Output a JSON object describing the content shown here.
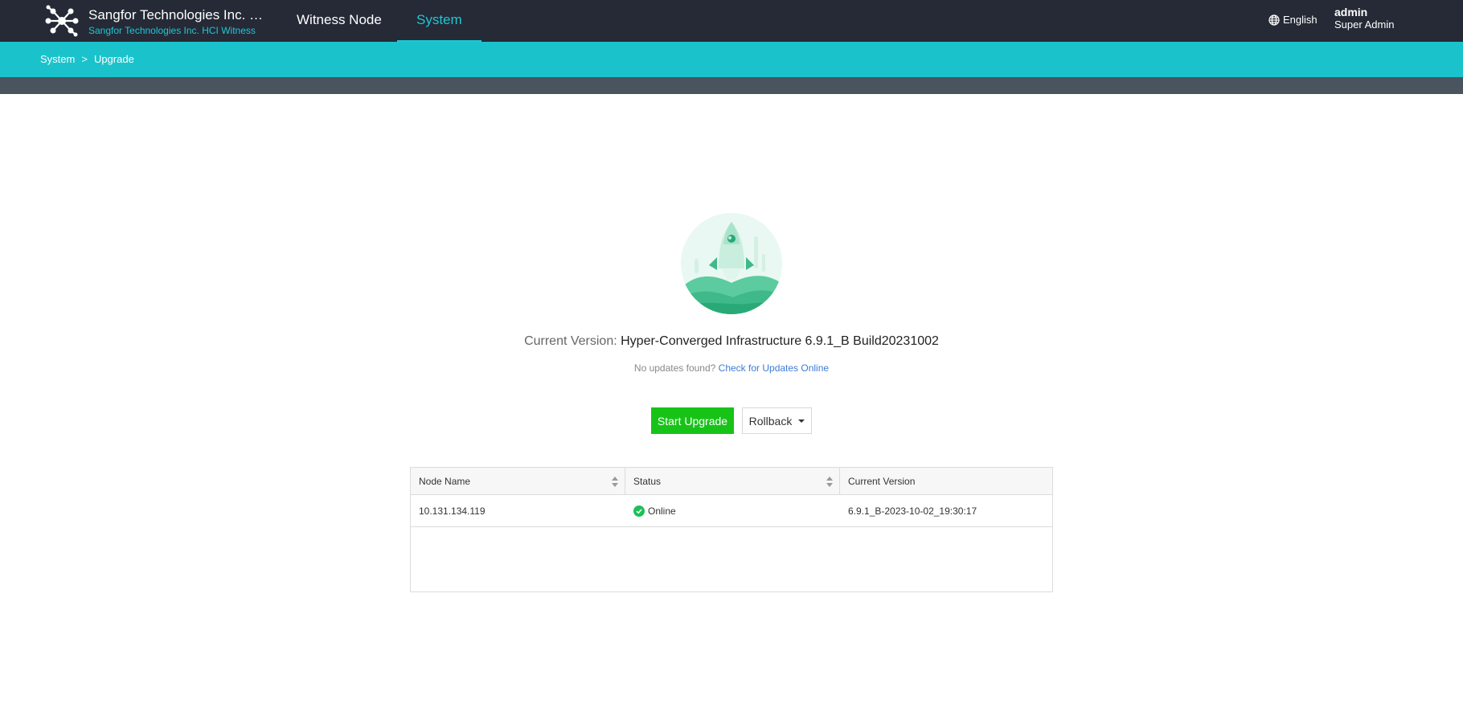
{
  "header": {
    "brand_title": "Sangfor Technologies Inc. HCI Witness",
    "brand_subtitle": "Sangfor Technologies Inc. HCI Witness",
    "nav": [
      {
        "label": "Witness Node",
        "active": false
      },
      {
        "label": "System",
        "active": true
      }
    ],
    "language": "English",
    "user_name": "admin",
    "user_role": "Super Admin"
  },
  "breadcrumb": {
    "items": [
      "System",
      "Upgrade"
    ],
    "separator": ">"
  },
  "upgrade": {
    "version_label": "Current Version:",
    "version_value": "Hyper-Converged Infrastructure 6.9.1_B Build20231002",
    "no_updates_text": "No updates found?",
    "check_link": "Check for Updates Online",
    "start_button": "Start Upgrade",
    "rollback_button": "Rollback"
  },
  "table": {
    "columns": [
      "Node Name",
      "Status",
      "Current Version"
    ],
    "rows": [
      {
        "node_name": "10.131.134.119",
        "status": "Online",
        "version": "6.9.1_B-2023-10-02_19:30:17"
      }
    ]
  },
  "colors": {
    "header_bg": "#252a36",
    "accent": "#1fc7d4",
    "breadcrumb_bg": "#1ac3cb",
    "upgrade_button": "#18c318",
    "online_status": "#1fbf5a",
    "link": "#3c7cd6"
  },
  "icons": {
    "logo": "network-nodes-logo",
    "language": "globe-icon",
    "status": "check-circle-icon",
    "illustration": "rocket-illustration"
  }
}
